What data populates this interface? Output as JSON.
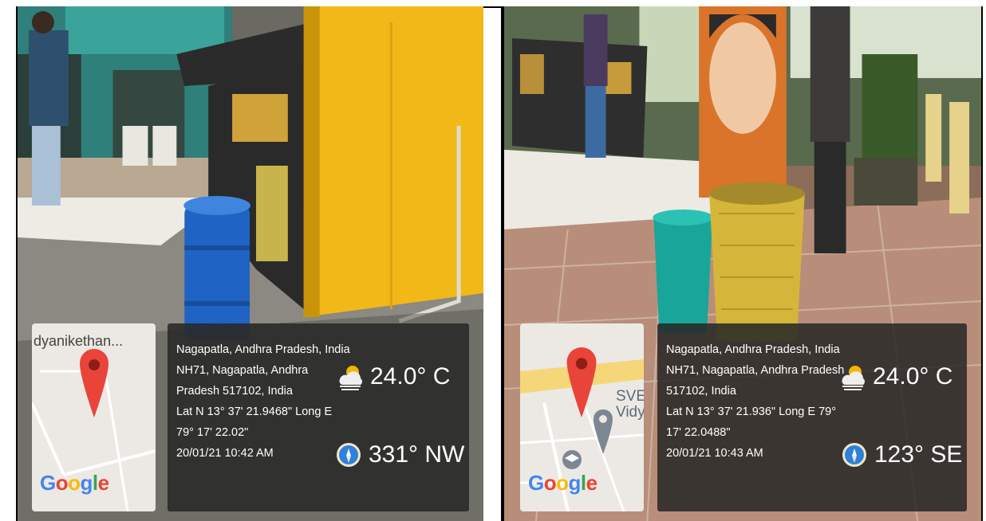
{
  "photos": [
    {
      "map": {
        "place_label": "dyanikethan...",
        "poi_label": "",
        "logo_text": "Google"
      },
      "location": {
        "city_line": "Nagapatla, Andhra Pradesh, India",
        "address_line_1": "NH71, Nagapatla, Andhra",
        "address_line_2": "Pradesh 517102, India",
        "coords_line_1": "Lat N 13° 37' 21.9468\" Long E",
        "coords_line_2": "79° 17' 22.02\"",
        "timestamp": "20/01/21 10:42 AM"
      },
      "weather": {
        "icon": "partly-sunny-icon",
        "temperature": "24.0° C"
      },
      "compass": {
        "icon": "compass-icon",
        "heading": "331° NW"
      }
    },
    {
      "map": {
        "place_label": "",
        "poi_label": "SVE\nVidy",
        "logo_text": "Google"
      },
      "location": {
        "city_line": "Nagapatla, Andhra Pradesh, India",
        "address_line_1": "NH71, Nagapatla, Andhra Pradesh",
        "address_line_2": "517102, India",
        "coords_line_1": "Lat N 13° 37' 21.936\" Long E 79°",
        "coords_line_2": "17' 22.0488\"",
        "timestamp": "20/01/21 10:43 AM"
      },
      "weather": {
        "icon": "partly-sunny-icon",
        "temperature": "24.0° C"
      },
      "compass": {
        "icon": "compass-icon",
        "heading": "123° SE"
      }
    }
  ],
  "colors": {
    "stall_yellow": "#f2b817",
    "barrel_blue": "#1f63c4",
    "bin_teal": "#1aa59a",
    "bin_yellow": "#d6b63a",
    "map_pin": "#e8443a"
  }
}
